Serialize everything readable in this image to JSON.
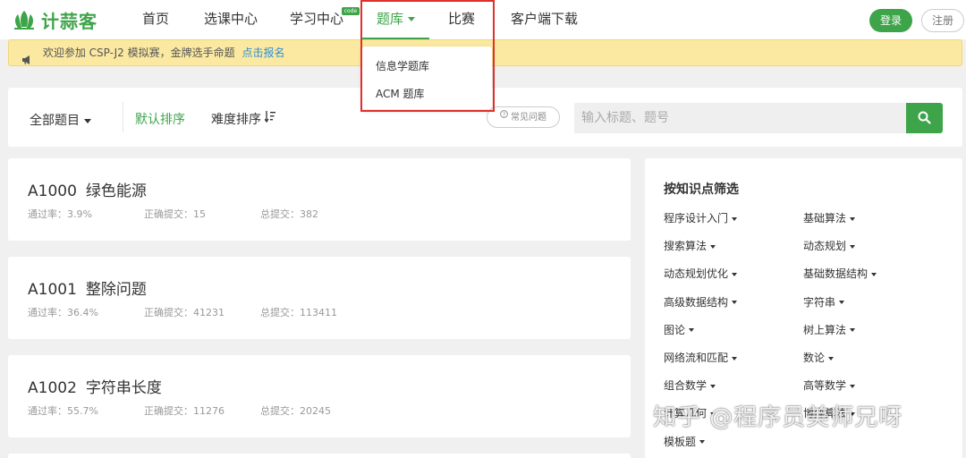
{
  "header": {
    "logo_text": "计蒜客",
    "nav": [
      {
        "label": "首页"
      },
      {
        "label": "选课中心"
      },
      {
        "label": "学习中心",
        "badge": "code"
      },
      {
        "label": "题库"
      },
      {
        "label": "比赛"
      },
      {
        "label": "客户端下载"
      }
    ],
    "login_label": "登录",
    "register_label": "注册"
  },
  "notice": {
    "text": "欢迎参加 CSP-J2 模拟赛，金牌选手命题",
    "link": "点击报名"
  },
  "dropdown": {
    "items": [
      {
        "label": "信息学题库"
      },
      {
        "label": "ACM 题库"
      }
    ]
  },
  "toolbar": {
    "all_label": "全部题目",
    "default_sort": "默认排序",
    "difficulty_sort": "难度排序",
    "faq_label": "常见问题",
    "search_placeholder": "输入标题、题号"
  },
  "problems": [
    {
      "id": "A1000",
      "title": "绿色能源",
      "pass_rate": "通过率：3.9%",
      "correct": "正确提交：15",
      "total": "总提交：382"
    },
    {
      "id": "A1001",
      "title": "整除问题",
      "pass_rate": "通过率：36.4%",
      "correct": "正确提交：41231",
      "total": "总提交：113411"
    },
    {
      "id": "A1002",
      "title": "字符串长度",
      "pass_rate": "通过率：55.7%",
      "correct": "正确提交：11276",
      "total": "总提交：20245"
    }
  ],
  "filter": {
    "title": "按知识点筛选",
    "items": [
      {
        "label": "程序设计入门"
      },
      {
        "label": "基础算法"
      },
      {
        "label": "搜索算法"
      },
      {
        "label": "动态规划"
      },
      {
        "label": "动态规划优化"
      },
      {
        "label": "基础数据结构"
      },
      {
        "label": "高级数据结构"
      },
      {
        "label": "字符串"
      },
      {
        "label": "图论"
      },
      {
        "label": "树上算法"
      },
      {
        "label": "网络流和匹配"
      },
      {
        "label": "数论"
      },
      {
        "label": "组合数学"
      },
      {
        "label": "高等数学"
      },
      {
        "label": "计算几何"
      },
      {
        "label": "博弈算法"
      },
      {
        "label": "模板题"
      }
    ]
  },
  "watermark": "知乎 @程序员美师兄呀",
  "colors": {
    "brand": "#3ea44a",
    "notice_bg": "#fbe9a1",
    "link": "#2c8edb",
    "highlight": "#e0302b"
  }
}
